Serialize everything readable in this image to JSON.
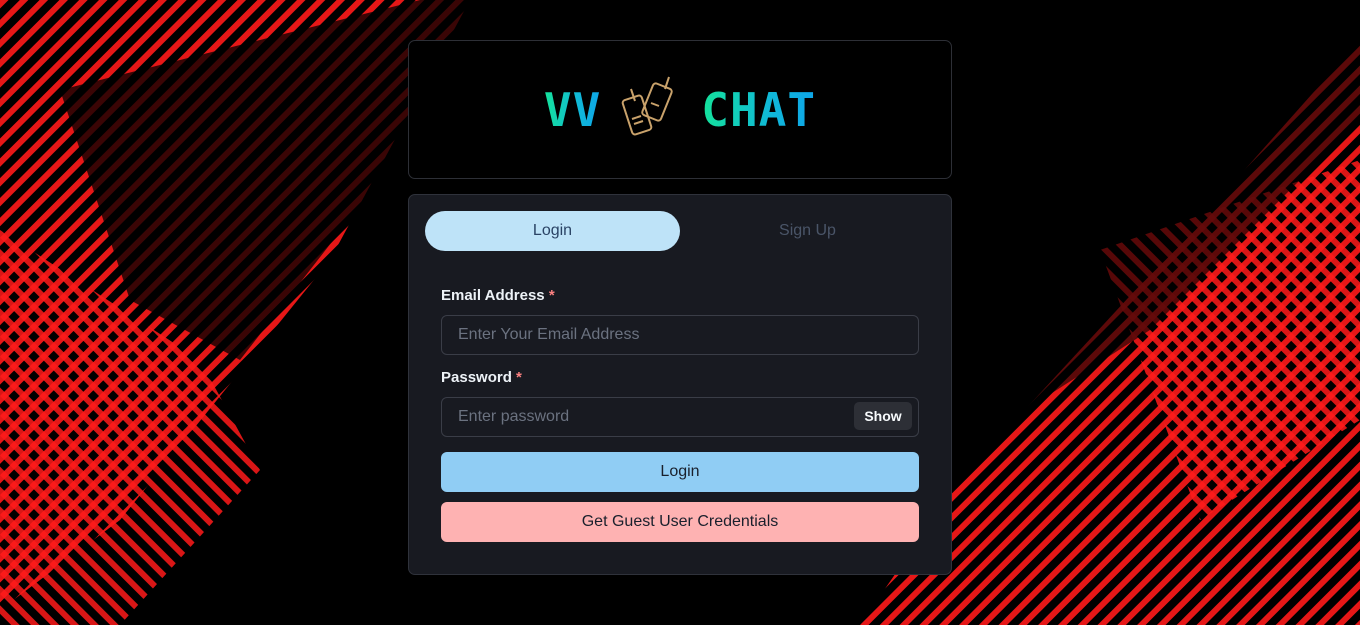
{
  "logo": {
    "left_text": "VV",
    "right_text": "CHAT",
    "icon": "walkie-talkie-icon",
    "gradient": [
      "#14e39a",
      "#0ea5e9"
    ]
  },
  "tabs": [
    {
      "label": "Login",
      "active": true
    },
    {
      "label": "Sign Up",
      "active": false
    }
  ],
  "form": {
    "email": {
      "label": "Email Address",
      "required_mark": "*",
      "placeholder": "Enter Your Email Address",
      "value": ""
    },
    "password": {
      "label": "Password",
      "required_mark": "*",
      "placeholder": "Enter password",
      "value": "",
      "toggle_label": "Show"
    },
    "login_button": "Login",
    "guest_button": "Get Guest User Credentials"
  },
  "colors": {
    "background_accent": "#ff1a1a",
    "tab_active": "#bee3f8",
    "login_button": "#90cdf4",
    "guest_button": "#feb2b2"
  }
}
